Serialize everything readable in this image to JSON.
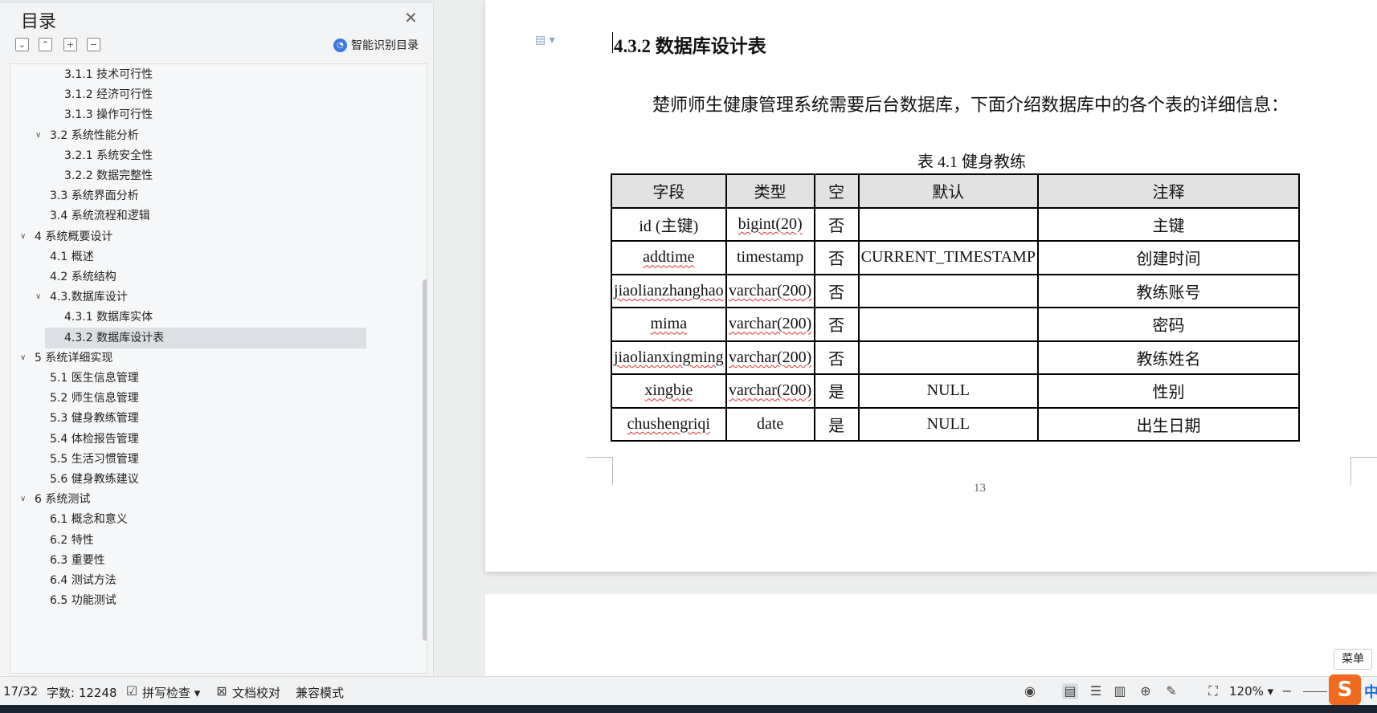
{
  "toc": {
    "title": "目录",
    "smart_label": "智能识别目录",
    "items": [
      {
        "label": "3.1.1 技术可行性",
        "level": 3
      },
      {
        "label": "3.1.2 经济可行性",
        "level": 3
      },
      {
        "label": "3.1.3 操作可行性",
        "level": 3
      },
      {
        "label": "3.2 系统性能分析",
        "level": 2,
        "expandable": true
      },
      {
        "label": "3.2.1  系统安全性",
        "level": 3
      },
      {
        "label": "3.2.2  数据完整性",
        "level": 3
      },
      {
        "label": "3.3 系统界面分析",
        "level": 2
      },
      {
        "label": "3.4 系统流程和逻辑",
        "level": 2
      },
      {
        "label": "4 系统概要设计",
        "level": 1,
        "expandable": true
      },
      {
        "label": "4.1 概述",
        "level": 2
      },
      {
        "label": "4.2 系统结构",
        "level": 2
      },
      {
        "label": "4.3.数据库设计",
        "level": 2,
        "expandable": true
      },
      {
        "label": "4.3.1 数据库实体",
        "level": 3
      },
      {
        "label": "4.3.2 数据库设计表",
        "level": 3,
        "selected": true
      },
      {
        "label": "5 系统详细实现",
        "level": 1,
        "expandable": true
      },
      {
        "label": "5.1  医生信息管理",
        "level": 2
      },
      {
        "label": "5.2  师生信息管理",
        "level": 2
      },
      {
        "label": "5.3  健身教练管理",
        "level": 2
      },
      {
        "label": "5.4  体检报告管理",
        "level": 2
      },
      {
        "label": "5.5  生活习惯管理",
        "level": 2
      },
      {
        "label": "5.6  健身教练建议",
        "level": 2
      },
      {
        "label": "6 系统测试",
        "level": 1,
        "expandable": true
      },
      {
        "label": "6.1 概念和意义",
        "level": 2
      },
      {
        "label": "6.2 特性",
        "level": 2
      },
      {
        "label": "6.3 重要性",
        "level": 2
      },
      {
        "label": "6.4 测试方法",
        "level": 2
      },
      {
        "label": "6.5  功能测试",
        "level": 2
      }
    ]
  },
  "document": {
    "heading": "4.3.2 数据库设计表",
    "paragraph": "楚师师生健康管理系统需要后台数据库，下面介绍数据库中的各个表的详细信息：",
    "caption": "表 4.1  健身教练",
    "table": {
      "headers": [
        "字段",
        "类型",
        "空",
        "默认",
        "注释"
      ],
      "rows": [
        [
          "id (主键)",
          "bigint(20)",
          "否",
          "",
          "主键"
        ],
        [
          "addtime",
          "timestamp",
          "否",
          "CURRENT_TIMESTAMP",
          "创建时间"
        ],
        [
          "jiaolianzhanghao",
          "varchar(200)",
          "否",
          "",
          "教练账号"
        ],
        [
          "mima",
          "varchar(200)",
          "否",
          "",
          "密码"
        ],
        [
          "jiaolianxingming",
          "varchar(200)",
          "否",
          "",
          "教练姓名"
        ],
        [
          "xingbie",
          "varchar(200)",
          "是",
          "NULL",
          "性别"
        ],
        [
          "chushengriqi",
          "date",
          "是",
          "NULL",
          "出生日期"
        ]
      ]
    },
    "page_number": "13",
    "menu_label": "菜单"
  },
  "status": {
    "page": "17/32",
    "word_count": "字数: 12248",
    "spell_check": "拼写检查",
    "doc_review": "文档校对",
    "compat_mode": "兼容模式",
    "zoom": "120%",
    "ime": "中"
  }
}
